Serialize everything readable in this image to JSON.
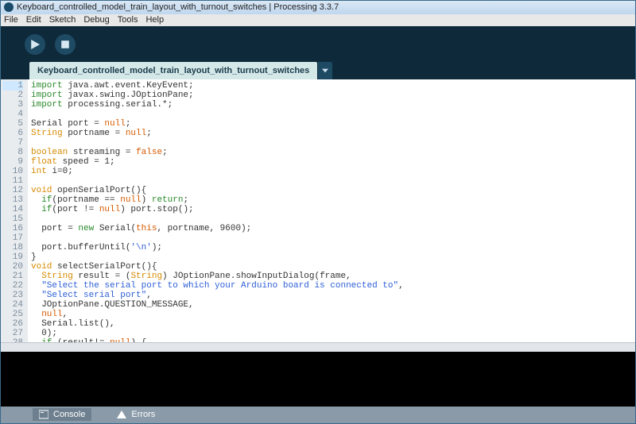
{
  "title": "Keyboard_controlled_model_train_layout_with_turnout_switches | Processing 3.3.7",
  "menu": [
    "File",
    "Edit",
    "Sketch",
    "Debug",
    "Tools",
    "Help"
  ],
  "toolbar": {
    "run": "Run",
    "stop": "Stop"
  },
  "tab": {
    "name": "Keyboard_controlled_model_train_layout_with_turnout_switches"
  },
  "code": [
    {
      "n": 1,
      "t": [
        [
          "kw",
          "import"
        ],
        [
          "",
          " java.awt.event.KeyEvent;"
        ]
      ]
    },
    {
      "n": 2,
      "t": [
        [
          "kw",
          "import"
        ],
        [
          "",
          " javax.swing.JOptionPane;"
        ]
      ]
    },
    {
      "n": 3,
      "t": [
        [
          "kw",
          "import"
        ],
        [
          "",
          " processing.serial.*;"
        ]
      ]
    },
    {
      "n": 4,
      "t": []
    },
    {
      "n": 5,
      "t": [
        [
          "",
          "Serial port = "
        ],
        [
          "lit",
          "null"
        ],
        [
          "",
          ";"
        ]
      ]
    },
    {
      "n": 6,
      "t": [
        [
          "type",
          "String"
        ],
        [
          "",
          " portname = "
        ],
        [
          "lit",
          "null"
        ],
        [
          "",
          ";"
        ]
      ]
    },
    {
      "n": 7,
      "t": []
    },
    {
      "n": 8,
      "t": [
        [
          "type",
          "boolean"
        ],
        [
          "",
          " streaming = "
        ],
        [
          "lit",
          "false"
        ],
        [
          "",
          ";"
        ]
      ]
    },
    {
      "n": 9,
      "t": [
        [
          "type",
          "float"
        ],
        [
          "",
          " speed = 1;"
        ]
      ]
    },
    {
      "n": 10,
      "t": [
        [
          "type",
          "int"
        ],
        [
          "",
          " i=0;"
        ]
      ]
    },
    {
      "n": 11,
      "t": []
    },
    {
      "n": 12,
      "t": [
        [
          "type",
          "void"
        ],
        [
          "",
          " openSerialPort(){"
        ]
      ]
    },
    {
      "n": 13,
      "t": [
        [
          "",
          "  "
        ],
        [
          "kw",
          "if"
        ],
        [
          "",
          "(portname == "
        ],
        [
          "lit",
          "null"
        ],
        [
          "",
          ") "
        ],
        [
          "kw",
          "return"
        ],
        [
          "",
          ";"
        ]
      ]
    },
    {
      "n": 14,
      "t": [
        [
          "",
          "  "
        ],
        [
          "kw",
          "if"
        ],
        [
          "",
          "(port != "
        ],
        [
          "lit",
          "null"
        ],
        [
          "",
          ") port.stop();"
        ]
      ]
    },
    {
      "n": 15,
      "t": []
    },
    {
      "n": 16,
      "t": [
        [
          "",
          "  port = "
        ],
        [
          "kw",
          "new"
        ],
        [
          "",
          " Serial("
        ],
        [
          "lit",
          "this"
        ],
        [
          "",
          ", portname, 9600);"
        ]
      ]
    },
    {
      "n": 17,
      "t": []
    },
    {
      "n": 18,
      "t": [
        [
          "",
          "  port.bufferUntil("
        ],
        [
          "str",
          "'\\n'"
        ],
        [
          "",
          ");"
        ]
      ]
    },
    {
      "n": 19,
      "t": [
        [
          "",
          "}"
        ]
      ]
    },
    {
      "n": 20,
      "t": [
        [
          "type",
          "void"
        ],
        [
          "",
          " selectSerialPort(){"
        ]
      ]
    },
    {
      "n": 21,
      "t": [
        [
          "",
          "  "
        ],
        [
          "type",
          "String"
        ],
        [
          "",
          " result = ("
        ],
        [
          "type",
          "String"
        ],
        [
          "",
          ") JOptionPane.showInputDialog(frame,"
        ]
      ]
    },
    {
      "n": 22,
      "t": [
        [
          "",
          "  "
        ],
        [
          "str",
          "\"Select the serial port to which your Arduino board is connected to\""
        ],
        [
          "",
          ","
        ]
      ]
    },
    {
      "n": 23,
      "t": [
        [
          "",
          "  "
        ],
        [
          "str",
          "\"Select serial port\""
        ],
        [
          "",
          ","
        ]
      ]
    },
    {
      "n": 24,
      "t": [
        [
          "",
          "  JOptionPane.QUESTION_MESSAGE,"
        ]
      ]
    },
    {
      "n": 25,
      "t": [
        [
          "",
          "  "
        ],
        [
          "lit",
          "null"
        ],
        [
          "",
          ","
        ]
      ]
    },
    {
      "n": 26,
      "t": [
        [
          "",
          "  Serial.list(),"
        ]
      ]
    },
    {
      "n": 27,
      "t": [
        [
          "",
          "  0);"
        ]
      ]
    },
    {
      "n": 28,
      "t": [
        [
          "",
          "  "
        ],
        [
          "kw",
          "if"
        ],
        [
          "",
          " (result!= "
        ],
        [
          "lit",
          "null"
        ],
        [
          "",
          ") {"
        ]
      ]
    }
  ],
  "bottombar": {
    "console": "Console",
    "errors": "Errors"
  }
}
